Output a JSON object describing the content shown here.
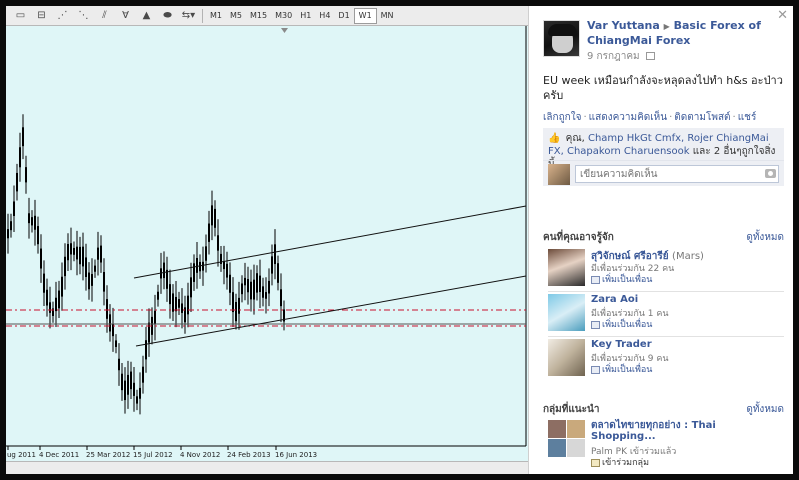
{
  "chart": {
    "timeframes": [
      "M1",
      "M5",
      "M15",
      "M30",
      "H1",
      "H4",
      "D1",
      "W1",
      "MN"
    ],
    "active_timeframe": "W1",
    "x_ticks": [
      "ug 2011",
      "4 Dec 2011",
      "25 Mar 2012",
      "15 Jul 2012",
      "4 Nov 2012",
      "24 Feb 2013",
      "16 Jun 2013"
    ],
    "colors": {
      "background": "#dff6f7",
      "candle": "#000000",
      "level": "#c8102e"
    }
  },
  "post": {
    "author": "Var Yuttana",
    "page": "Basic Forex of ChiangMai Forex",
    "date": "9 กรกฎาคม",
    "message": "EU week เหมือนกำลังจะหลุดลงไปทำ h&s อะป่าวครับ",
    "actions": {
      "unlike": "เลิกถูกใจ",
      "comment": "แสดงความคิดเห็น",
      "follow": "ติดตามโพสต์",
      "share": "แชร์"
    },
    "likes": {
      "prefix": "คุณ,",
      "names": [
        "Champ HkGt Cmfx,",
        "Rojer ChiangMai FX,",
        "Chapakorn Charuensook"
      ],
      "suffix": "และ 2 อื่นๆถูกใจสิ่งนี้"
    },
    "comment_placeholder": "เขียนความคิดเห็น"
  },
  "people": {
    "header": "คนที่คุณอาจรู้จัก",
    "see_all": "ดูทั้งหมด",
    "add_label": "เพิ่มเป็นเพื่อน",
    "items": [
      {
        "name": "สุวิจักษณ์ ศรีอารีย์",
        "alt": "(Mars)",
        "mutual": "มีเพื่อนร่วมกัน 22 คน"
      },
      {
        "name": "Zara Aoi",
        "alt": "",
        "mutual": "มีเพื่อนร่วมกัน 1 คน"
      },
      {
        "name": "Key Trader",
        "alt": "",
        "mutual": "มีเพื่อนร่วมกัน 9 คน"
      }
    ]
  },
  "groups": {
    "header": "กลุ่มที่แนะนำ",
    "see_all": "ดูทั้งหมด",
    "item": {
      "name": "ตลาดไทขายทุกอย่าง : Thai Shopping...",
      "member": "Palm PK เข้าร่วมแล้ว",
      "join": "เข้าร่วมกลุ่ม"
    }
  }
}
